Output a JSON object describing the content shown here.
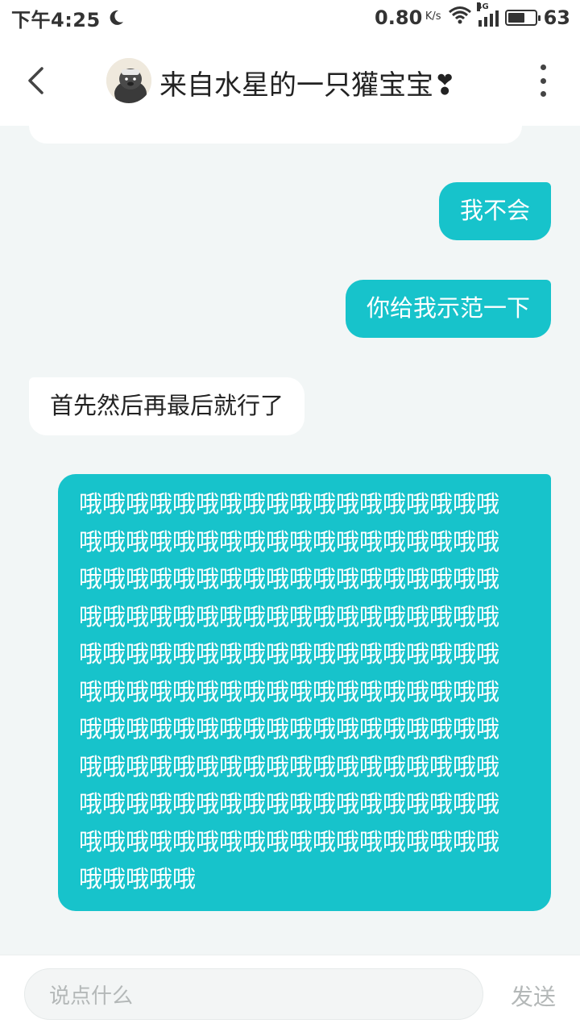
{
  "status_bar": {
    "time": "下午4:25",
    "net_speed": "0.80",
    "net_unit": "K/s",
    "network_type": "4G",
    "battery_level": "63",
    "icons": [
      "moon-icon",
      "wifi-icon",
      "signal-icon",
      "battery-icon"
    ]
  },
  "header": {
    "title": "来自水星的一只獾宝宝❣",
    "back_icon": "chevron-left-icon",
    "more_icon": "more-vertical-icon"
  },
  "messages": [
    {
      "side": "in",
      "text": ""
    },
    {
      "side": "out",
      "text": "我不会"
    },
    {
      "side": "out",
      "text": "你给我示范一下"
    },
    {
      "side": "in",
      "text": "首先然后再最后就行了"
    },
    {
      "side": "out",
      "text": "哦哦哦哦哦哦哦哦哦哦哦哦哦哦哦哦哦哦哦哦哦哦哦哦哦哦哦哦哦哦哦哦哦哦哦哦哦哦哦哦哦哦哦哦哦哦哦哦哦哦哦哦哦哦哦哦哦哦哦哦哦哦哦哦哦哦哦哦哦哦哦哦哦哦哦哦哦哦哦哦哦哦哦哦哦哦哦哦哦哦哦哦哦哦哦哦哦哦哦哦哦哦哦哦哦哦哦哦哦哦哦哦哦哦哦哦哦哦哦哦哦哦哦哦哦哦哦哦哦哦哦哦哦哦哦哦哦哦哦哦哦哦哦哦哦哦哦哦哦哦哦哦哦哦哦哦哦哦哦哦哦哦哦哦哦哦哦哦哦哦哦哦哦哦哦哦哦哦哦哦哦哦哦哦哦"
    }
  ],
  "input": {
    "placeholder": "说点什么",
    "send_label": "发送"
  },
  "colors": {
    "accent": "#17c3cb",
    "background": "#f2f6f6",
    "incoming_bubble": "#ffffff"
  }
}
